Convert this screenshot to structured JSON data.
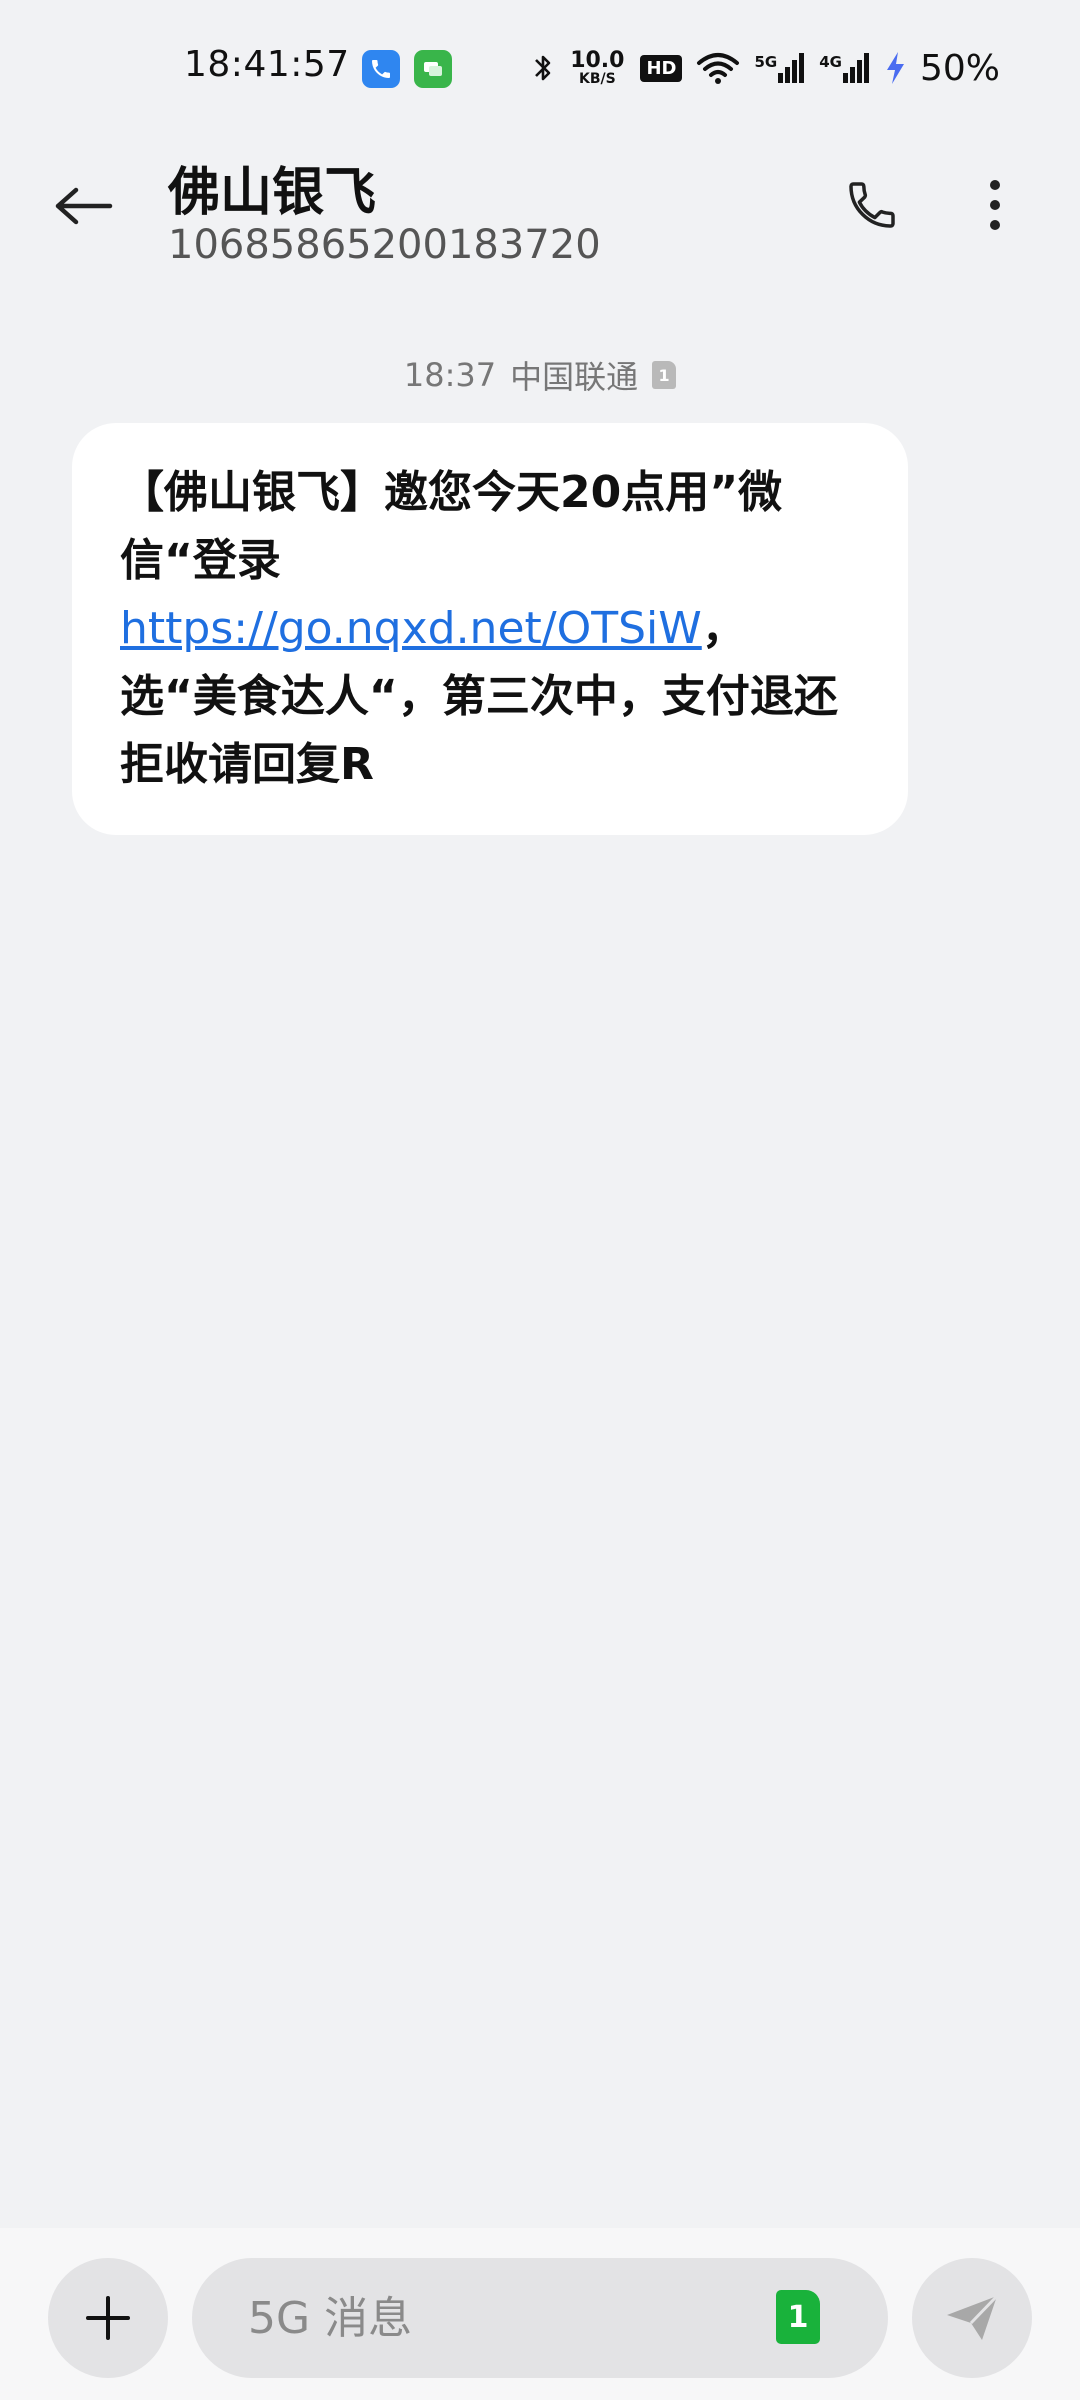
{
  "status_bar": {
    "time": "18:41:57",
    "net_speed_value": "10.0",
    "net_speed_unit": "KB/S",
    "hd_label": "HD",
    "signal1_label": "5G",
    "signal2_label": "4G",
    "battery": "50%",
    "icons": [
      "phone-notification-icon",
      "message-notification-icon",
      "bluetooth-icon",
      "wifi-icon",
      "signal-icon",
      "charging-icon"
    ]
  },
  "header": {
    "contact_name": "佛山银飞",
    "contact_number": "10685865200183720"
  },
  "conversation": {
    "time": "18:37",
    "carrier": "中国联通",
    "sim_badge": "1",
    "message": {
      "part1": "【佛山银飞】邀您今天20点用”微信“登录",
      "link": "https://go.nqxd.net/OTSiW",
      "part2": "，选“美食达人“，第三次中，支付退还拒收请回复R"
    }
  },
  "composer": {
    "placeholder": "5G 消息",
    "sim_label": "1"
  },
  "colors": {
    "background": "#f1f2f4",
    "link": "#1f6fe0",
    "sim_green": "#19b23b"
  }
}
